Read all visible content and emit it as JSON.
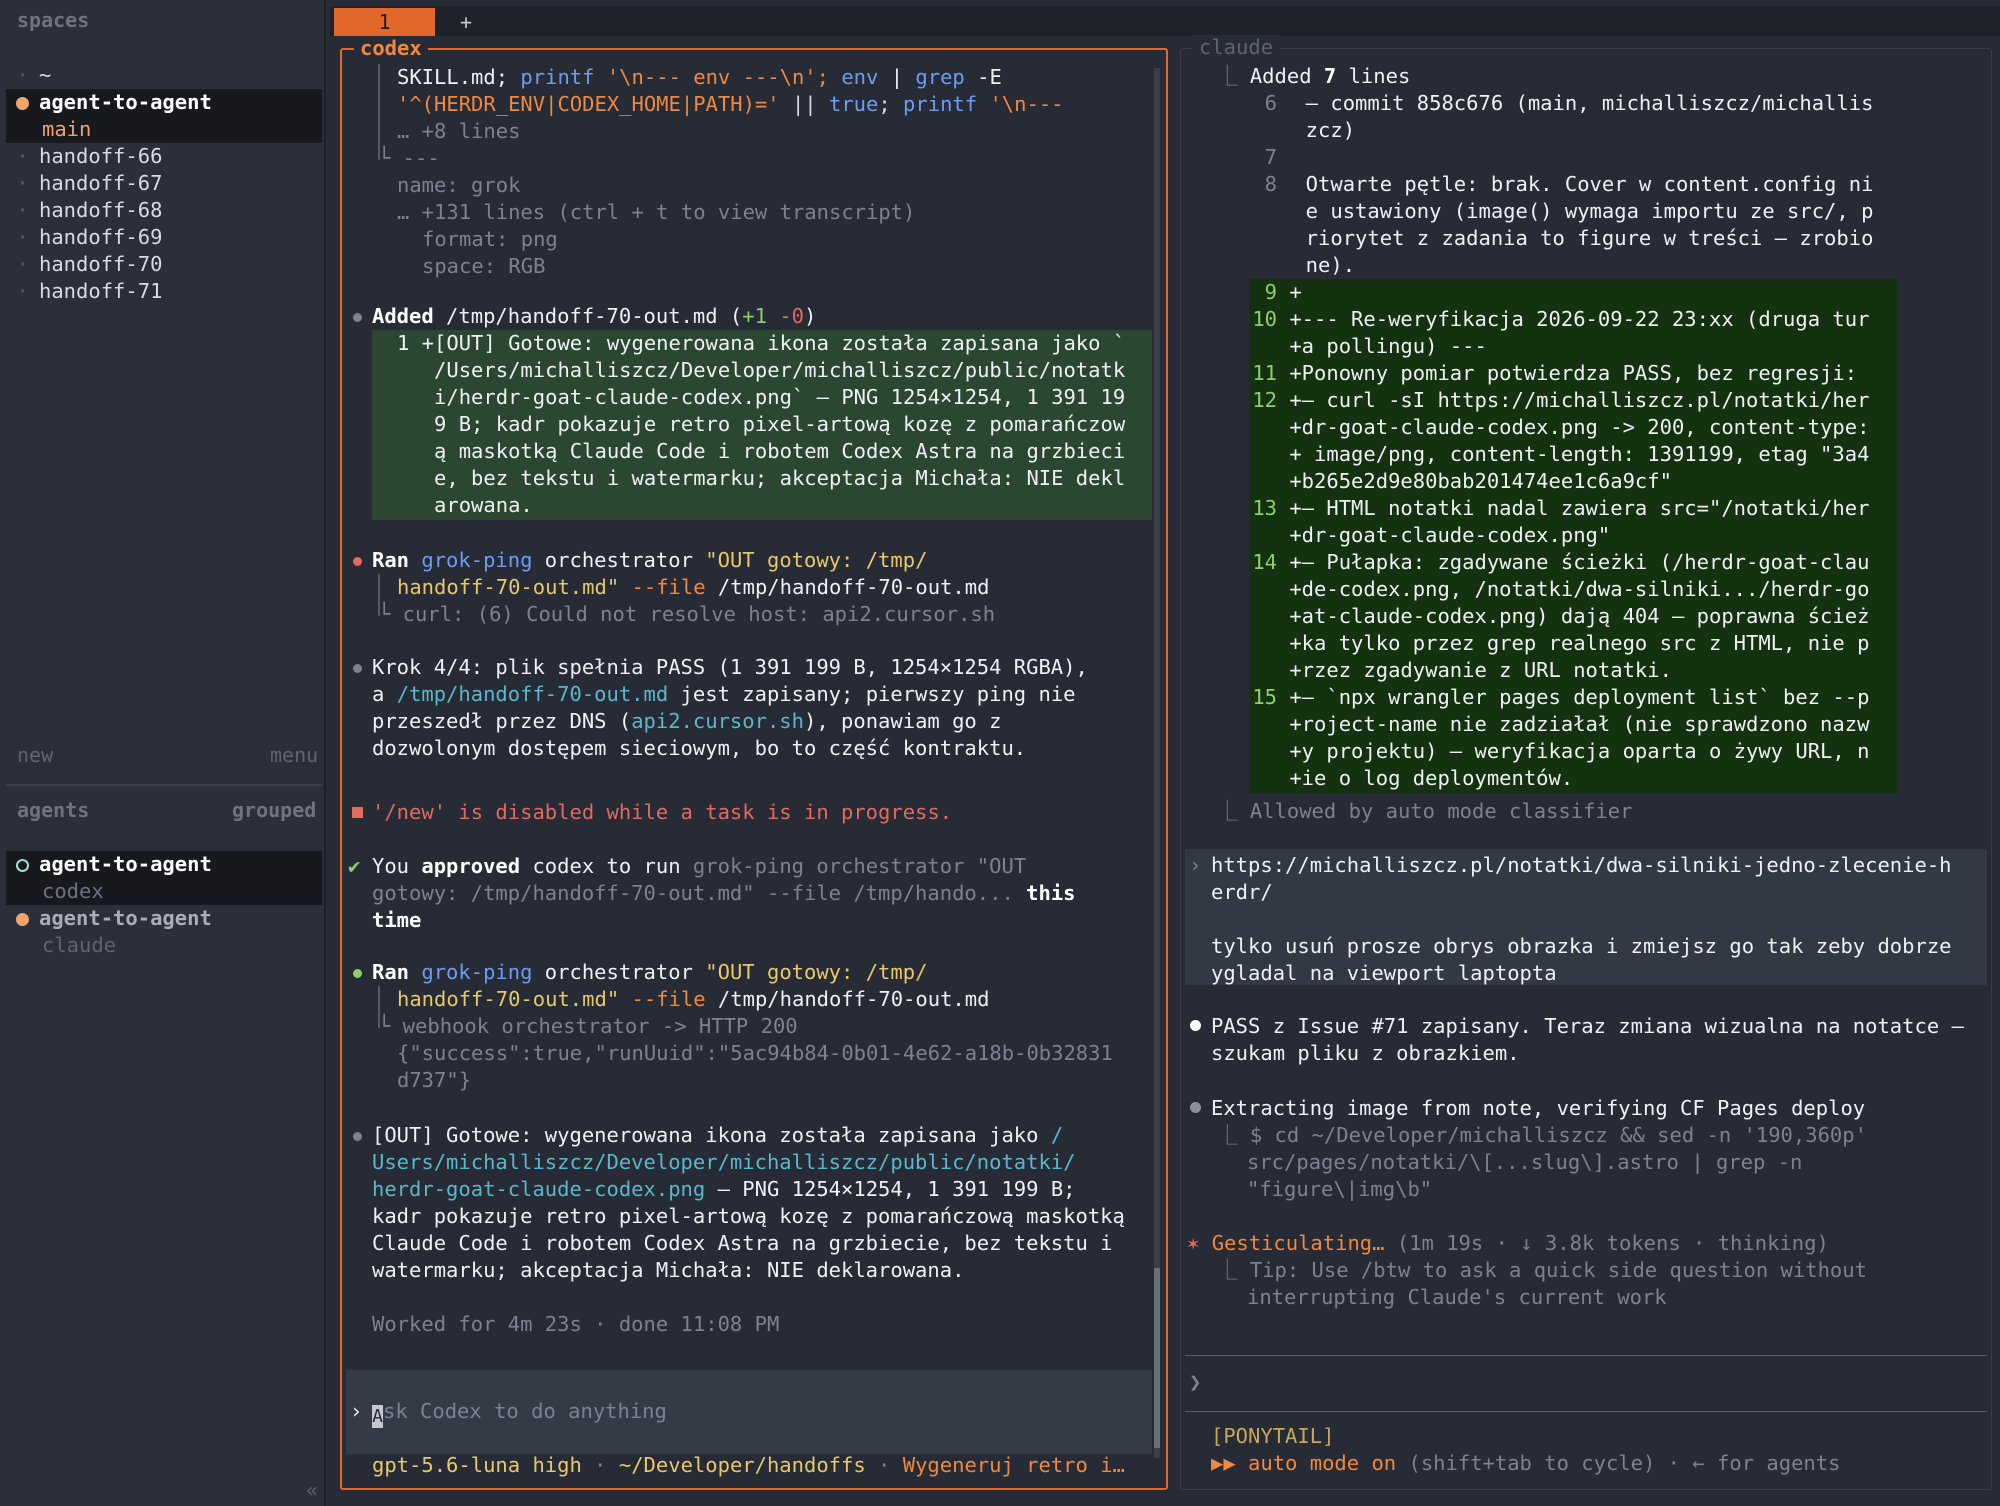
{
  "sidebar": {
    "spaces_header": "spaces",
    "items": [
      {
        "label": "~"
      },
      {
        "label": "agent-to-agent",
        "sub": "main"
      },
      {
        "label": "handoff-66"
      },
      {
        "label": "handoff-67"
      },
      {
        "label": "handoff-68"
      },
      {
        "label": "handoff-69"
      },
      {
        "label": "handoff-70"
      },
      {
        "label": "handoff-71"
      }
    ],
    "new_label": "new",
    "menu_label": "menu",
    "agents_header": "agents",
    "grouped_label": "grouped",
    "agents": [
      {
        "label": "agent-to-agent",
        "sub": "codex"
      },
      {
        "label": "agent-to-agent",
        "sub": "claude"
      }
    ],
    "collapse_glyph": "«"
  },
  "tabs": {
    "active": "1",
    "add": "+"
  },
  "codex": {
    "title": "codex",
    "l1": "SKILL.md; ",
    "l1b": "printf",
    "l1c": " '\\n--- env ---\\n'; ",
    "l1d": "env",
    "l1e": " | ",
    "l1f": "grep",
    "l1g": " -E",
    "l2": "'^(HERDR_ENV|CODEX_HOME|PATH)='",
    "l2b": " || ",
    "l2c": "true",
    "l2d": "; ",
    "l2e": "printf",
    "l2f": " '\\n---",
    "l3": "… +8 lines",
    "l4": "└ ---",
    "l5": "name: grok",
    "l6": "… +131 lines (ctrl + t to view transcript)",
    "l7": "format: png",
    "l8": "space: RGB",
    "added_label": "Added",
    "added_path": " /tmp/handoff-70-out.md (",
    "added_plus": "+1",
    "added_minus": " -0",
    "added_close": ")",
    "diff_lines": [
      "1 +[OUT] Gotowe: wygenerowana ikona została zapisana jako `",
      "   /Users/michalliszcz/Developer/michalliszcz/public/notatk",
      "   i/herdr-goat-claude-codex.png` — PNG 1254×1254, 1 391 19",
      "   9 B; kadr pokazuje retro pixel-artową kozę z pomarańczow",
      "   ą maskotką Claude Code i robotem Codex Astra na grzbieci",
      "   e, bez tekstu i watermarku; akceptacja Michała: NIE dekl",
      "   arowana."
    ],
    "ran1_label": "Ran",
    "ran1_cmd": "grok-ping",
    "ran1_arg": " orchestrator ",
    "ran1_str": "\"OUT gotowy: /tmp/",
    "ran1_l2": "handoff-70-out.md\"",
    "ran1_flag": " --file",
    "ran1_path": " /tmp/handoff-70-out.md",
    "ran1_out": "└ curl: (6) Could not resolve host: api2.cursor.sh",
    "krok_l1": "Krok 4/4: plik spełnia PASS (1 391 199 B, 1254×1254 RGBA),",
    "krok_l2a": "a ",
    "krok_l2b": "/tmp/handoff-70-out.md",
    "krok_l2c": " jest zapisany; pierwszy ping nie",
    "krok_l3a": "przeszedł przez DNS (",
    "krok_l3b": "api2.cursor.sh",
    "krok_l3c": "), ponawiam go z",
    "krok_l4": "dozwolonym dostępem sieciowym, bo to część kontraktu.",
    "error_text": "'/new' is disabled while a task is in progress.",
    "approved_a": "You ",
    "approved_b": "approved",
    "approved_c": " codex to run ",
    "approved_d": "grok-ping orchestrator \"OUT",
    "approved_l2": "gotowy: /tmp/handoff-70-out.md\" --file /tmp/hando... ",
    "approved_l2b": "this",
    "approved_l3": "time",
    "ran2_label": "Ran",
    "ran2_cmd": "grok-ping",
    "ran2_arg": " orchestrator ",
    "ran2_str": "\"OUT gotowy: /tmp/",
    "ran2_l2": "handoff-70-out.md\"",
    "ran2_flag": " --file",
    "ran2_path": " /tmp/handoff-70-out.md",
    "ran2_out1": "└ webhook orchestrator -> HTTP 200",
    "ran2_out2": "{\"success\":true,\"runUuid\":\"5ac94b84-0b01-4e62-a18b-0b32831",
    "ran2_out3": "d737\"}",
    "out_l1a": "[OUT] Gotowe: wygenerowana ikona została zapisana jako ",
    "out_l1b": "/",
    "out_l2": "Users/michalliszcz/Developer/michalliszcz/public/notatki/",
    "out_l3a": "herdr-goat-claude-codex.png",
    "out_l3b": " — PNG 1254×1254, 1 391 199 B;",
    "out_l4": "kadr pokazuje retro pixel-artową kozę z pomarańczową maskotką",
    "out_l5": "Claude Code i robotem Codex Astra na grzbiecie, bez tekstu i",
    "out_l6": "watermarku; akceptacja Michała: NIE deklarowana.",
    "worked": "Worked for 4m 23s · done 11:08 PM",
    "input_placeholder": "sk Codex to do anything",
    "input_first": "A",
    "status_model": "gpt-5.6-luna high",
    "status_sep": " · ",
    "status_path": "~/Developer/handoffs",
    "status_task": "Wygeneruj retro i…"
  },
  "claude": {
    "title": "claude",
    "added_label": "Added ",
    "added_count": "7",
    "added_suffix": " lines",
    "ctx_lines": [
      {
        "n": "6",
        "t": "  – commit 858c676 (main, michalliszcz/michallis"
      },
      {
        "n": "",
        "t": "  zcz)"
      },
      {
        "n": "7",
        "t": ""
      },
      {
        "n": "8",
        "t": "  Otwarte pętle: brak. Cover w content.config ni"
      },
      {
        "n": "",
        "t": "  e ustawiony (image() wymaga importu ze src/, p"
      },
      {
        "n": "",
        "t": "  riorytet z zadania to figure w treści — zrobio"
      },
      {
        "n": "",
        "t": "  ne)."
      }
    ],
    "add_lines": [
      {
        "n": "9",
        "t": " +"
      },
      {
        "n": "10",
        "t": " +--- Re-weryfikacja 2026-09-22 23:xx (druga tur"
      },
      {
        "n": "",
        "t": " +a pollingu) ---"
      },
      {
        "n": "11",
        "t": " +Ponowny pomiar potwierdza PASS, bez regresji:"
      },
      {
        "n": "12",
        "t": " +– curl -sI https://michalliszcz.pl/notatki/her"
      },
      {
        "n": "",
        "t": " +dr-goat-claude-codex.png -> 200, content-type:"
      },
      {
        "n": "",
        "t": " + image/png, content-length: 1391199, etag \"3a4"
      },
      {
        "n": "",
        "t": " +b265e2d9e80bab201474ee1c6a9cf\""
      },
      {
        "n": "13",
        "t": " +– HTML notatki nadal zawiera src=\"/notatki/her"
      },
      {
        "n": "",
        "t": " +dr-goat-claude-codex.png\""
      },
      {
        "n": "14",
        "t": " +– Pułapka: zgadywane ścieżki (/herdr-goat-clau"
      },
      {
        "n": "",
        "t": " +de-codex.png, /notatki/dwa-silniki.../herdr-go"
      },
      {
        "n": "",
        "t": " +at-claude-codex.png) dają 404 — poprawna ścież"
      },
      {
        "n": "",
        "t": " +ka tylko przez grep realnego src z HTML, nie p"
      },
      {
        "n": "",
        "t": " +rzez zgadywanie z URL notatki."
      },
      {
        "n": "15",
        "t": " +– `npx wrangler pages deployment list` bez --p"
      },
      {
        "n": "",
        "t": " +roject-name nie zadziałał (nie sprawdzono nazw"
      },
      {
        "n": "",
        "t": " +y projektu) — weryfikacja oparta o żywy URL, n"
      },
      {
        "n": "",
        "t": " +ie o log deploymentów."
      }
    ],
    "allowed": "⎿ Allowed by auto mode classifier",
    "prompt_l1": "https://michalliszcz.pl/notatki/dwa-silniki-jedno-zlecenie-h",
    "prompt_l2": "erdr/",
    "prompt_l3": "tylko usuń prosze obrys obrazka i zmiejsz go tak zeby dobrze",
    "prompt_l4": "ygladal na viewport laptopta",
    "pass_l1": "PASS z Issue #71 zapisany. Teraz zmiana wizualna na notatce –",
    "pass_l2": "szukam pliku z obrazkiem.",
    "extract_l1": "Extracting image from note, verifying CF Pages deploy",
    "extract_l2": "⎿ $ cd ~/Developer/michalliszcz && sed -n '190,360p'",
    "extract_l3": "src/pages/notatki/\\[...slug\\].astro | grep -n",
    "extract_l4": "\"figure\\|img\\b\"",
    "gest_star": "✶",
    "gest_label": "Gesticulating…",
    "gest_meta": " (1m 19s · ↓ 3.8k tokens · thinking)",
    "tip_l1": "⎿ Tip: Use /btw to ask a quick side question without",
    "tip_l2": "interrupting Claude's current work",
    "input_prompt": "❯",
    "ponytail": "[PONYTAIL]",
    "auto_a": "▶▶ auto mode on",
    "auto_b": " (shift+tab to cycle) · ← for agents"
  }
}
